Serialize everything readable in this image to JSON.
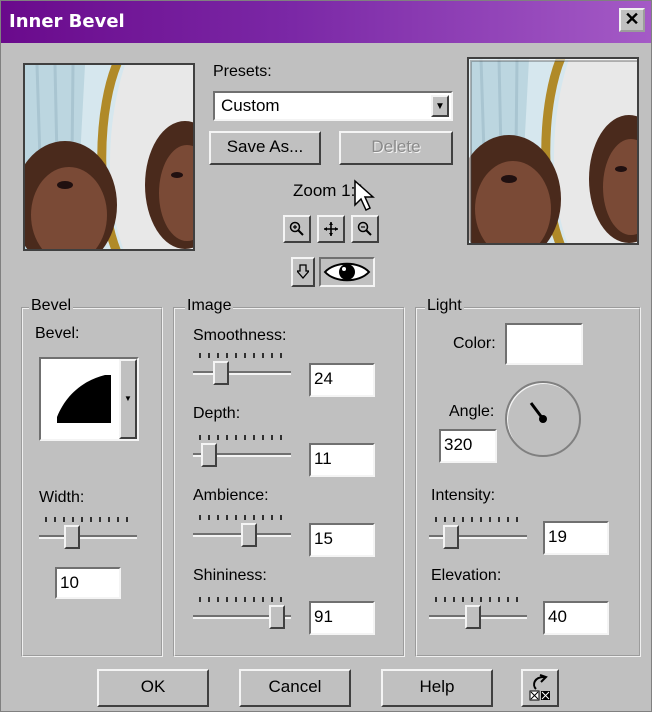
{
  "window": {
    "title": "Inner Bevel",
    "close_symbol": "✕"
  },
  "presets": {
    "label": "Presets:",
    "value": "Custom",
    "save_as": "Save As...",
    "delete": "Delete"
  },
  "zoom": {
    "label": "Zoom 1:1"
  },
  "bevel_group": {
    "title": "Bevel",
    "bevel_label": "Bevel:",
    "width_label": "Width:",
    "width_value": "10",
    "width_level": 0.32
  },
  "image_group": {
    "title": "Image",
    "smoothness_label": "Smoothness:",
    "smoothness_value": "24",
    "depth_label": "Depth:",
    "depth_value": "11",
    "ambience_label": "Ambience:",
    "ambience_value": "15",
    "shininess_label": "Shininess:",
    "shininess_value": "91"
  },
  "light_group": {
    "title": "Light",
    "color_label": "Color:",
    "color_value": "#ffffff",
    "angle_label": "Angle:",
    "angle_value": "320",
    "intensity_label": "Intensity:",
    "intensity_value": "19",
    "elevation_label": "Elevation:",
    "elevation_value": "40"
  },
  "buttons": {
    "ok": "OK",
    "cancel": "Cancel",
    "help": "Help"
  },
  "colors": {
    "titlebar": "#6a0a8c",
    "dialog": "#c0c0c0"
  }
}
